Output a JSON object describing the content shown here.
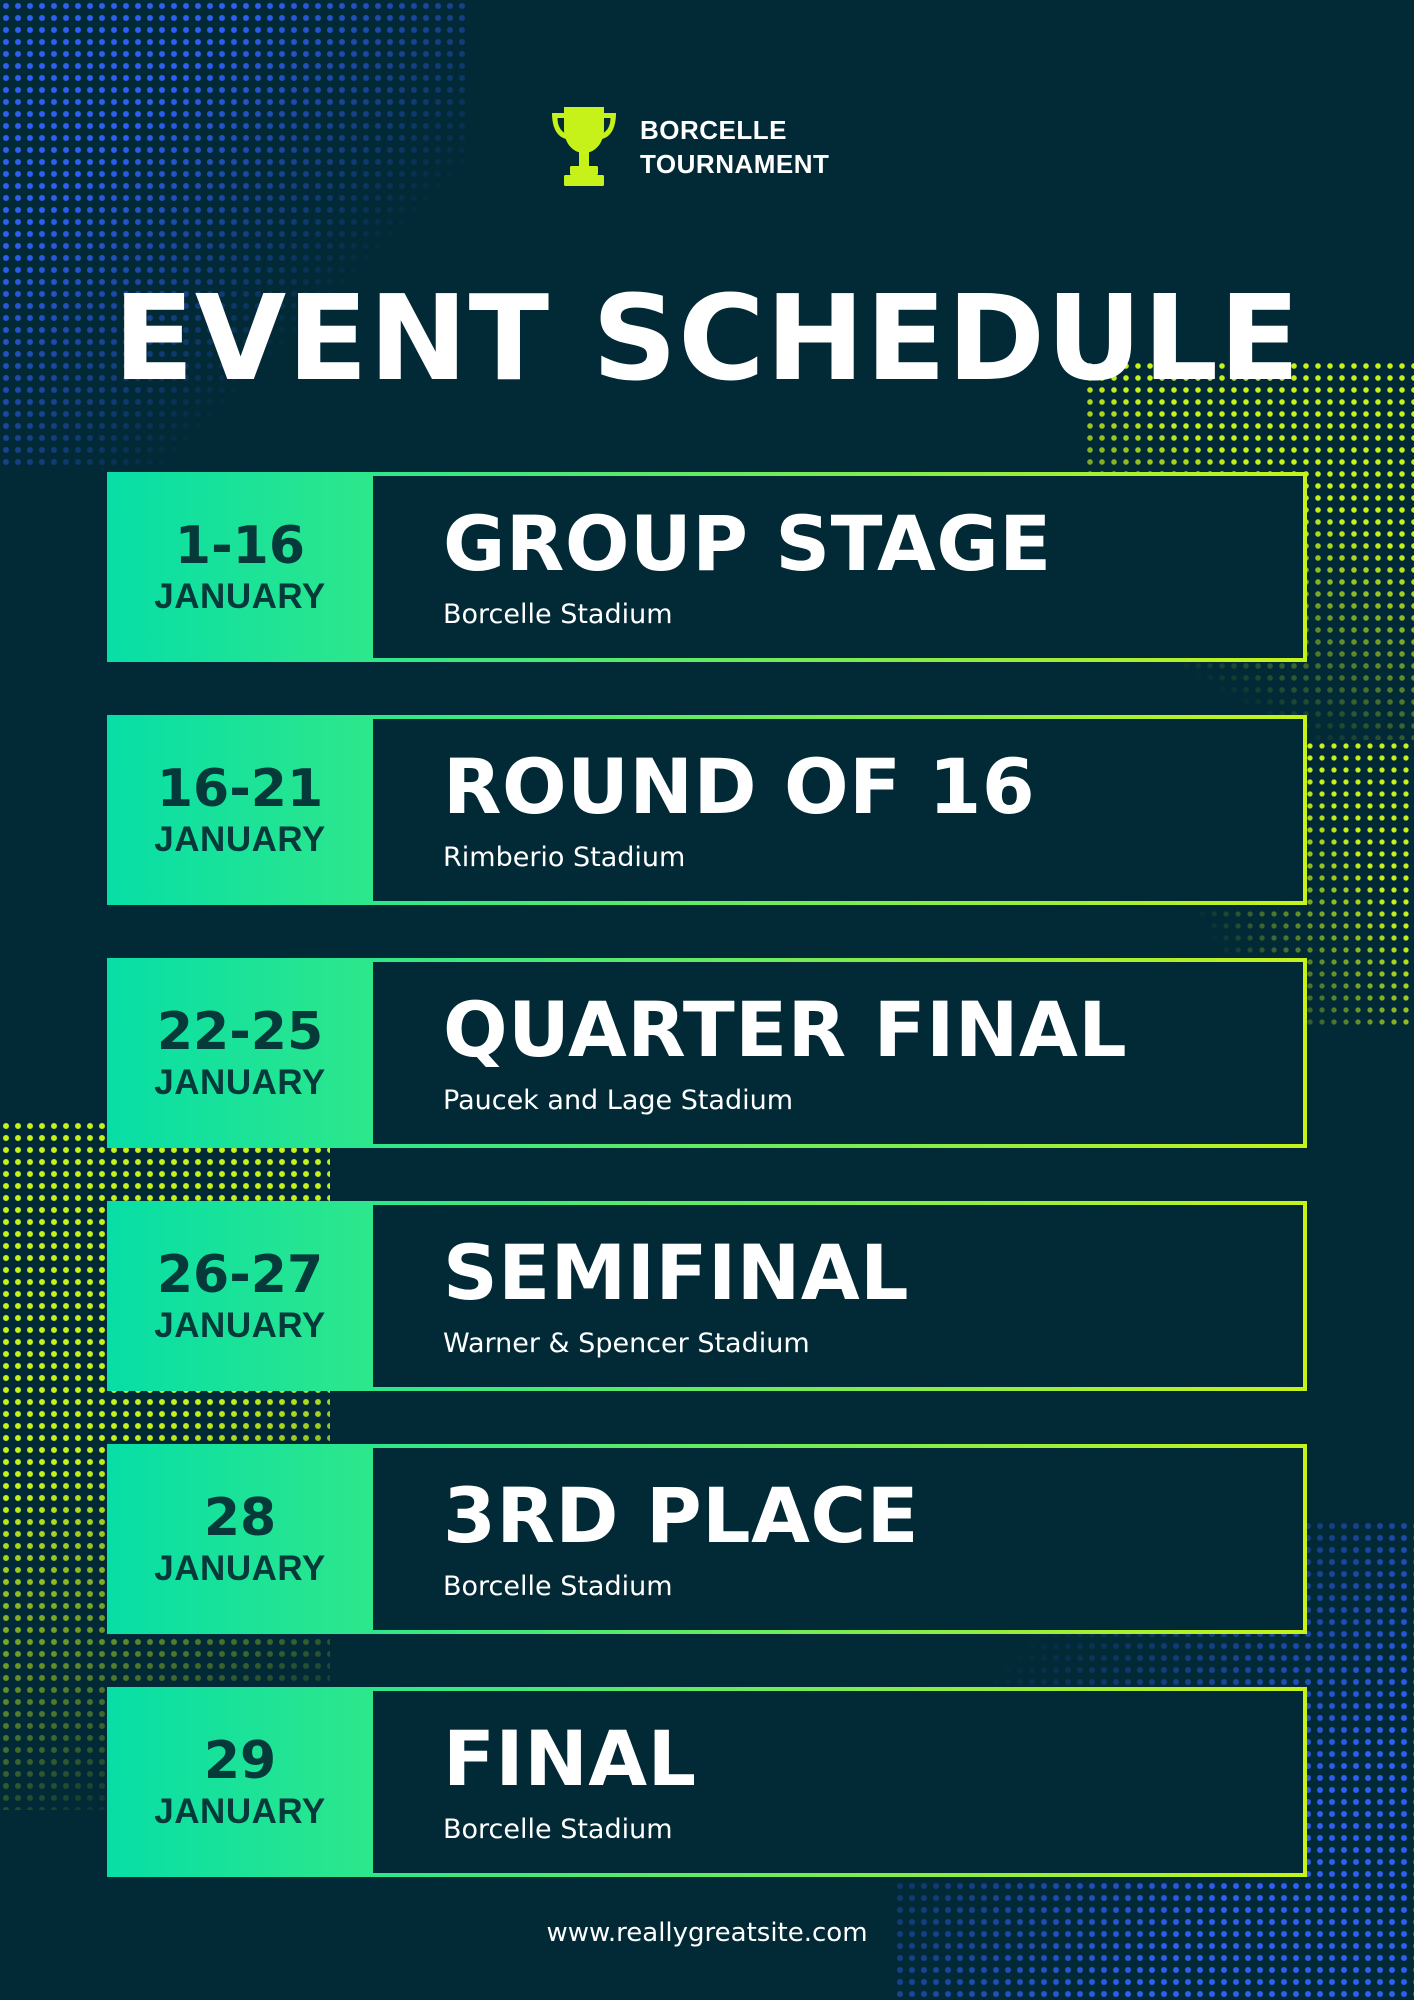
{
  "brand": {
    "icon": "trophy-icon",
    "line1": "BORCELLE",
    "line2": "TOURNAMENT"
  },
  "title": "EVENT SCHEDULE",
  "schedule": [
    {
      "date": "1-16",
      "month": "JANUARY",
      "event": "GROUP STAGE",
      "venue": "Borcelle Stadium"
    },
    {
      "date": "16-21",
      "month": "JANUARY",
      "event": "ROUND OF 16",
      "venue": "Rimberio Stadium"
    },
    {
      "date": "22-25",
      "month": "JANUARY",
      "event": "QUARTER FINAL",
      "venue": "Paucek and Lage Stadium"
    },
    {
      "date": "26-27",
      "month": "JANUARY",
      "event": "SEMIFINAL",
      "venue": "Warner & Spencer Stadium"
    },
    {
      "date": "28",
      "month": "JANUARY",
      "event": "3RD PLACE",
      "venue": "Borcelle Stadium"
    },
    {
      "date": "29",
      "month": "JANUARY",
      "event": "FINAL",
      "venue": "Borcelle Stadium"
    }
  ],
  "footer": {
    "website": "www.reallygreatsite.com"
  },
  "colors": {
    "background": "#022a36",
    "accent_lime": "#c6f21a",
    "accent_green": "#07dea6",
    "accent_blue": "#2e5ef2",
    "date_text": "#063a3a",
    "text": "#ffffff"
  }
}
